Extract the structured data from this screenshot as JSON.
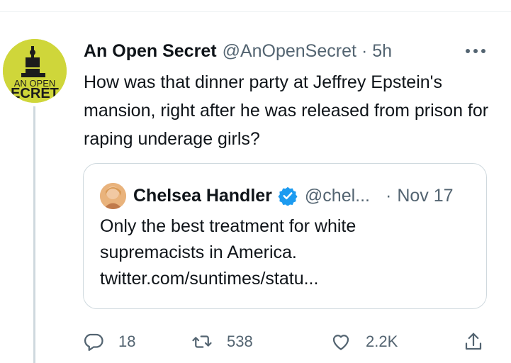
{
  "tweet": {
    "author_name": "An Open Secret",
    "handle": "@AnOpenSecret",
    "separator": "·",
    "time": "5h",
    "more_icon": "more-horizontal-icon",
    "avatar_text": "AN OPEN SECRET",
    "text": "How was that dinner party at Jeffrey Epstein's mansion, right after he was released from prison for raping underage girls?"
  },
  "quoted": {
    "author_name": "Chelsea Handler",
    "verified_icon": "verified-badge-icon",
    "handle": "@chel...",
    "separator": "·",
    "time": "Nov 17",
    "text_line1": "Only the best treatment for white",
    "text_line2": "supremacists in America.",
    "text_line3": "twitter.com/suntimes/statu..."
  },
  "actions": {
    "reply_count": "18",
    "retweet_count": "538",
    "like_count": "2.2K"
  },
  "colors": {
    "text": "#0f1419",
    "secondary": "#536471",
    "verified": "#1d9bf0",
    "avatar_bg": "#cfd63a"
  }
}
